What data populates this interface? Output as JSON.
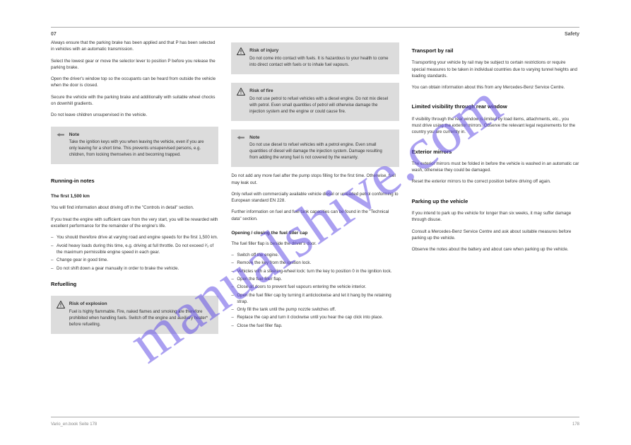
{
  "watermark": "manualshive.com",
  "header": {
    "left": "07",
    "right": "Safety"
  },
  "col1": {
    "p1": "Always ensure that the parking brake has been applied and that P has been selected in vehicles with an automatic transmission.",
    "p2": "Select the lowest gear or move the selector lever to position P before you release the parking brake.",
    "p3": "Open the driver's window top so the occupants can be heard from outside the vehicle when the door is closed.",
    "p4": "Secure the vehicle with the parking brake and additionally with suitable wheel chocks on downhill gradients.",
    "p5": "Do not leave children unsupervised in the vehicle.",
    "box1": {
      "head": "Note",
      "text": "Take the ignition keys with you when leaving the vehicle, even if you are only leaving for a short time. This prevents unsupervised persons, e.g. children, from locking themselves in and becoming trapped."
    },
    "s1head": "Running-in notes",
    "s1p1": "The first 1,500 km",
    "s1p2": "You will find information about driving off in the \"Controls in detail\" section.",
    "s1p3": "If you treat the engine with sufficient care from the very start, you will be rewarded with excellent performance for the remainder of the engine's life.",
    "s1list": [
      "You should therefore drive at varying road and engine speeds for the first 1,500 km.",
      "Avoid heavy loads during this time, e.g. driving at full throttle. Do not exceed ²⁄₃ of the maximum permissible engine speed in each gear.",
      "Change gear in good time.",
      "Do not shift down a gear manually in order to brake the vehicle."
    ],
    "s2head": "Refuelling",
    "box2": {
      "head": "Risk of explosion",
      "text": "Fuel is highly flammable. Fire, naked flames and smoking are therefore prohibited when handling fuels. Switch off the engine and auxiliary heater* before refuelling."
    }
  },
  "col2": {
    "box1": {
      "head": "Risk of injury",
      "text": "Do not come into contact with fuels. It is hazardous to your health to come into direct contact with fuels or to inhale fuel vapours."
    },
    "box2": {
      "head": "Risk of fire",
      "text": "Do not use petrol to refuel vehicles with a diesel engine. Do not mix diesel with petrol. Even small quantities of petrol will otherwise damage the injection system and the engine or could cause fire."
    },
    "box3": {
      "head": "Note",
      "text": "Do not use diesel to refuel vehicles with a petrol engine. Even small quantities of diesel will damage the injection system. Damage resulting from adding the wrong fuel is not covered by the warranty."
    },
    "p1": "Do not add any more fuel after the pump stops filling for the first time. Otherwise, fuel may leak out.",
    "p2": "Only refuel with commercially available vehicle diesel or unleaded petrol conforming to European standard EN 228.",
    "p3": "Further information on fuel and fuel tank capacities can be found in the \"Technical data\" section.",
    "s1head": "Opening / closing the fuel filler cap",
    "s1p1": "The fuel filler flap is beside the driver's door.",
    "s1list": [
      "Switch off the engine.",
      "Remove the key from the ignition lock.",
      "Vehicles with a steering-wheel lock: turn the key to position 0 in the ignition lock.",
      "Open the fuel filler flap.",
      "Close all doors to prevent fuel vapours entering the vehicle interior.",
      "Open the fuel filler cap by turning it anticlockwise and let it hang by the retaining strap.",
      "Only fill the tank until the pump nozzle switches off.",
      "Replace the cap and turn it clockwise until you hear the cap click into place.",
      "Close the fuel filler flap."
    ]
  },
  "col3": {
    "s1head": "Transport by rail",
    "s1p1": "Transporting your vehicle by rail may be subject to certain restrictions or require special measures to be taken in individual countries due to varying tunnel heights and loading standards.",
    "s1p2": "You can obtain information about this from any Mercedes-Benz Service Centre.",
    "s2head": "Limited visibility through rear window",
    "s2p1": "If visibility through the rear window is limited by load items, attachments, etc., you must drive using the exterior mirrors. Observe the relevant legal requirements for the country you are currently in.",
    "s3head": "Exterior mirrors",
    "s3p1": "The exterior mirrors must be folded in before the vehicle is washed in an automatic car wash, otherwise they could be damaged.",
    "s3p2": "Reset the exterior mirrors to the correct position before driving off again.",
    "s4head": "Parking up the vehicle",
    "s4p1": "If you intend to park up the vehicle for longer than six weeks, it may suffer damage through disuse.",
    "s4p2": "Consult a Mercedes-Benz Service Centre and ask about suitable measures before parking up the vehicle.",
    "s4p3": "Observe the notes about the battery and about care when parking up the vehicle."
  },
  "footer": {
    "left": "Vario_en.book Seite 178",
    "right": "178"
  }
}
